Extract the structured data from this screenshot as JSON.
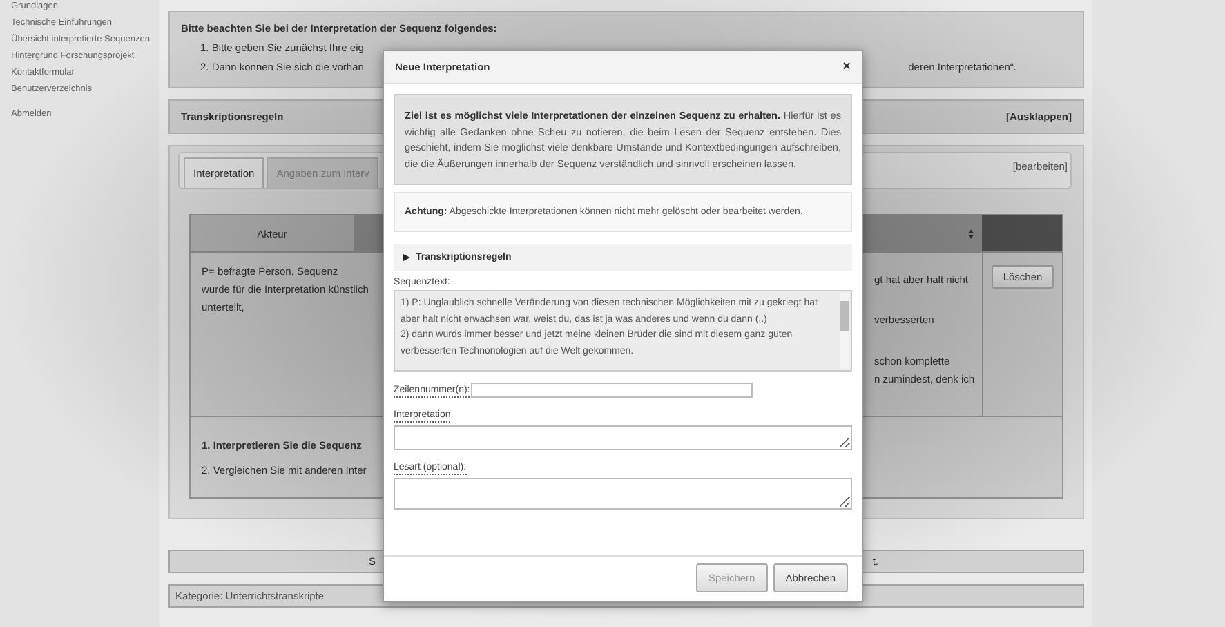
{
  "sidebar": {
    "items": [
      {
        "label": "Grundlagen"
      },
      {
        "label": "Technische Einführungen"
      },
      {
        "label": "Übersicht interpretierte Sequenzen"
      },
      {
        "label": "Hintergrund Forschungsprojekt"
      },
      {
        "label": "Kontaktformular"
      },
      {
        "label": "Benutzerverzeichnis"
      },
      {
        "label": "Abmelden"
      }
    ]
  },
  "notice": {
    "title": "Bitte beachten Sie bei der Interpretation der Sequenz folgendes:",
    "items": [
      {
        "text": "1. Bitte geben Sie zunächst Ihre eig"
      },
      {
        "text": "2. Dann können Sie sich die vorhan",
        "tail": "deren Interpretationen“."
      }
    ]
  },
  "rules_bar": {
    "title": "Transkriptionsregeln",
    "action": "[Ausklappen]"
  },
  "tabs": [
    {
      "label": "Interpretation",
      "selected": true
    },
    {
      "label": "Angaben zum Interv",
      "selected": false
    }
  ],
  "tabs_action": "[bearbeiten]",
  "table": {
    "header": "Akteur",
    "akteur_lines": [
      "P= befragte Person, Sequenz",
      "wurde für die Interpretation künstlich",
      "unterteilt,"
    ],
    "right_lines": [
      "gt hat aber halt nicht",
      "verbesserten",
      "schon komplette",
      "n zumindest, denk ich"
    ],
    "delete_button": "Löschen"
  },
  "tasks": [
    {
      "text": "1. Interpretieren Sie die Sequenz",
      "bold": true
    },
    {
      "text": "2. Vergleichen Sie mit anderen Inter",
      "bold": false
    }
  ],
  "bar": {
    "left": "S",
    "right": "t."
  },
  "category": "Kategorie:  Unterrichtstranskripte",
  "dialog": {
    "title": "Neue Interpretation",
    "close": "×",
    "info": "**Ziel ist es möglichst viele Interpretationen der einzelnen Sequenz zu erhalten.** Hierfür ist es wichtig alle Gedanken ohne Scheu zu notieren, die beim Lesen der Sequenz entstehen. Dies geschieht, indem Sie möglichst viele denkbare Umstände und Kontextbedingungen aufschreiben, die die Äußerungen innerhalb der Sequenz verständlich und sinnvoll erscheinen lassen.",
    "warning": "**Achtung:** Abgeschickte Interpretationen können nicht mehr gelöscht oder bearbeitet werden.",
    "rules": {
      "label": "Transkriptionsregeln",
      "expanded": false
    },
    "sequence_label": "Sequenztext:",
    "sequence_text": "1) P: Unglaublich schnelle Veränderung von diesen technischen Möglichkeiten mit zu gekriegt hat aber halt nicht erwachsen war, weist du, das ist ja was anderes und wenn du dann (..)\n2) dann wurds immer besser und jetzt meine kleinen Brüder die sind mit diesem ganz guten verbesserten Technonologien auf die Welt gekommen.",
    "line_label": "Zeilennummer(n):",
    "interpretation_label": "Interpretation",
    "reading_label": "Lesart (optional):",
    "buttons": [
      {
        "label": "Speichern",
        "disabled": true
      },
      {
        "label": "Abbrechen",
        "disabled": false
      }
    ]
  }
}
